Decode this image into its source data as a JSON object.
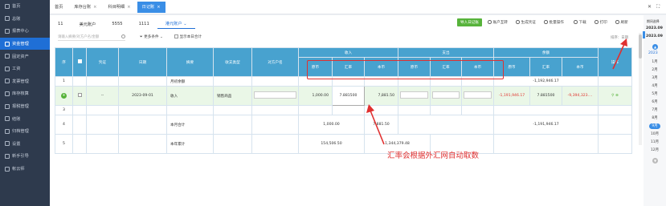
{
  "sidebar": {
    "items": [
      {
        "label": "首页",
        "icon": "home-icon"
      },
      {
        "label": "总账",
        "icon": "ledger-icon"
      },
      {
        "label": "报表中心",
        "icon": "report-icon"
      },
      {
        "label": "资金管理",
        "icon": "fund-icon",
        "active": true
      },
      {
        "label": "固定资产",
        "icon": "asset-icon"
      },
      {
        "label": "工资",
        "icon": "salary-icon"
      },
      {
        "label": "发票管理",
        "icon": "invoice-icon"
      },
      {
        "label": "库存核算",
        "icon": "inventory-icon"
      },
      {
        "label": "报税管理",
        "icon": "tax-icon"
      },
      {
        "label": "结账",
        "icon": "close-icon"
      },
      {
        "label": "归档管理",
        "icon": "archive-icon"
      },
      {
        "label": "设置",
        "icon": "gear-icon"
      },
      {
        "label": "新手引导",
        "icon": "guide-icon"
      },
      {
        "label": "帐云师",
        "icon": "user-icon"
      }
    ]
  },
  "tabs": [
    {
      "label": "首页",
      "closable": false
    },
    {
      "label": "库存台账",
      "closable": true
    },
    {
      "label": "科目明细",
      "closable": true
    },
    {
      "label": "日记账",
      "closable": true,
      "active": true
    }
  ],
  "accounts": [
    "11",
    "美元账户",
    "5555",
    "1111",
    "港元账户"
  ],
  "toolbar": {
    "import": "导入日记账",
    "combine": "账户互转",
    "generate_voucher": "生成凭证",
    "batch": "批量操作",
    "download": "下载",
    "print": "打印",
    "refresh": "刷新"
  },
  "filter": {
    "search_placeholder": "请输入摘要/对方户名/金额",
    "more": "更多条件",
    "show_summary": "显示本日合计",
    "sort_label": "排序：",
    "sort_value": "日期"
  },
  "table": {
    "headers": {
      "seq": "序",
      "voucher": "凭证",
      "date": "日期",
      "summary": "摘要",
      "category": "收支类型",
      "counterparty": "对方户名",
      "income": "收入",
      "expense": "支出",
      "balance": "余额",
      "ops": "操作",
      "orig": "原币",
      "rate": "汇率",
      "local": "本币"
    },
    "rows": [
      {
        "seq": "1",
        "voucher": "",
        "date": "",
        "summary": "月初余额",
        "category": "",
        "counterparty": "",
        "in_orig": "",
        "in_rate": "",
        "in_local": "",
        "out_orig": "",
        "out_rate": "",
        "out_local": "",
        "bal_orig": "-1,192,946.17",
        "bal_rate": "",
        "bal_local": ""
      },
      {
        "seq": "",
        "voucher": "--",
        "date": "2023-09-01",
        "summary": "收入",
        "category": "销售商品",
        "counterparty": "",
        "in_orig": "1,000.00",
        "in_rate": "7.881500",
        "in_local": "7,881.50",
        "out_orig": "",
        "out_rate": "",
        "out_local": "",
        "bal_orig": "-1,191,946.17",
        "bal_rate": "7.881500",
        "bal_local": "-9,394,323...."
      },
      {
        "seq": "3",
        "voucher": "",
        "date": "",
        "summary": "",
        "category": "",
        "counterparty": "",
        "in_orig": "",
        "in_rate": "",
        "in_local": "",
        "out_orig": "",
        "out_rate": "",
        "out_local": "",
        "bal_orig": "",
        "bal_rate": "",
        "bal_local": ""
      },
      {
        "seq": "4",
        "voucher": "",
        "date": "",
        "summary": "本月合计",
        "category": "",
        "counterparty": "",
        "in_orig": "1,000.00",
        "in_rate": "",
        "in_local": "7,881.50",
        "out_orig": "",
        "out_rate": "",
        "out_local": "",
        "bal_orig": "-1,191,946.17",
        "bal_rate": "",
        "bal_local": ""
      },
      {
        "seq": "5",
        "voucher": "",
        "date": "",
        "summary": "本年累计",
        "category": "",
        "counterparty": "",
        "in_orig": "154,506.50",
        "in_rate": "",
        "in_local": "1,344,379.48",
        "out_orig": "",
        "out_rate": "",
        "out_local": "",
        "bal_orig": "",
        "bal_rate": "",
        "bal_local": ""
      }
    ]
  },
  "period_panel": {
    "title": "期间选择",
    "start": "2023.09",
    "end": "2023.09",
    "year": "2023",
    "months": [
      "1月",
      "2月",
      "3月",
      "4月",
      "5月",
      "6月",
      "7月",
      "8月",
      "9月",
      "10月",
      "11月",
      "12月"
    ],
    "selected_month": "9月"
  },
  "annotation": "汇率会根据外汇网自动取数",
  "colors": {
    "accent": "#1f6fd6",
    "header": "#48a2cf",
    "sidebar": "#2e3a4d",
    "annotation": "#e03030",
    "green": "#57b33b"
  }
}
